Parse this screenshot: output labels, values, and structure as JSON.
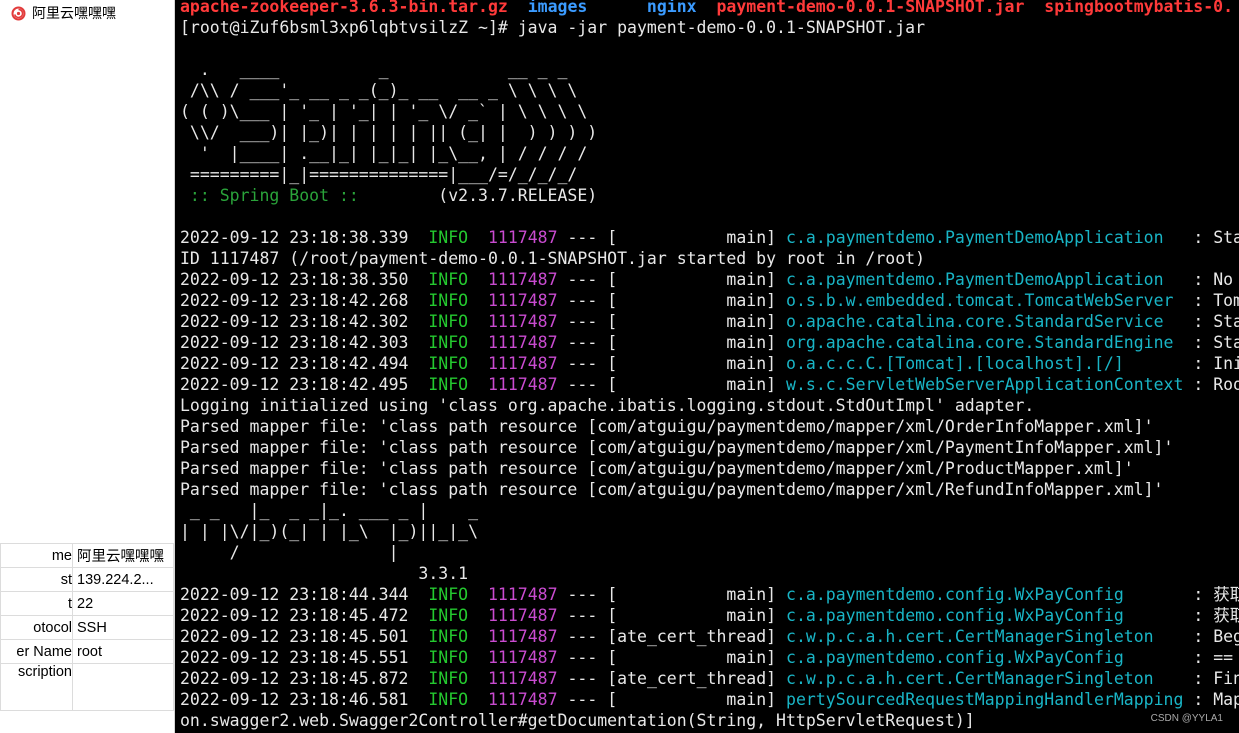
{
  "sidebar": {
    "session_name": "阿里云嘿嘿嘿",
    "properties": [
      {
        "key": "me",
        "value": "阿里云嘿嘿嘿"
      },
      {
        "key": "st",
        "value": "139.224.2..."
      },
      {
        "key": "t",
        "value": "22"
      },
      {
        "key": "otocol",
        "value": "SSH"
      },
      {
        "key": "er Name",
        "value": "root"
      },
      {
        "key": "scription",
        "value": ""
      }
    ]
  },
  "terminal": {
    "listing": [
      "apache-zookeeper-3.6.3-bin.tar.gz",
      "images",
      "nginx",
      "payment-demo-0.0.1-SNAPSHOT.jar",
      "spingbootmybatis-0."
    ],
    "prompt": "[root@iZuf6bsml3xp6lqbtvsilzZ ~]# java -jar payment-demo-0.0.1-SNAPSHOT.jar",
    "spring_banner": [
      "  .   ____          _            __ _ _",
      " /\\\\ / ___'_ __ _ _(_)_ __  __ _ \\ \\ \\ \\",
      "( ( )\\___ | '_ | '_| | '_ \\/ _` | \\ \\ \\ \\",
      " \\\\/  ___)| |_)| | | | | || (_| |  ) ) ) )",
      "  '  |____| .__|_| |_|_| |_\\__, | / / / /",
      " =========|_|==============|___/=/_/_/_/"
    ],
    "spring_boot_label": " :: Spring Boot :: ",
    "spring_boot_version": "       (v2.3.7.RELEASE)",
    "mybatis_banner": [
      " _ _   |_  _ _|_. ___ _ |    _",
      "| | |\\/|_)(_| | |_\\  |_)||_|_\\",
      "     /               |"
    ],
    "mybatis_version": "                        3.3.1",
    "log_group_1": [
      {
        "time": "2022-09-12 23:18:38.339",
        "level": "INFO",
        "pid": "1117487",
        "sep": " --- ",
        "thread": "[           main]",
        "logger": "c.a.paymentdemo.PaymentDemoApplication  ",
        "msg": " : Sta"
      },
      {
        "plain": "ID 1117487 (/root/payment-demo-0.0.1-SNAPSHOT.jar started by root in /root)"
      },
      {
        "time": "2022-09-12 23:18:38.350",
        "level": "INFO",
        "pid": "1117487",
        "sep": " --- ",
        "thread": "[           main]",
        "logger": "c.a.paymentdemo.PaymentDemoApplication  ",
        "msg": " : No"
      },
      {
        "time": "2022-09-12 23:18:42.268",
        "level": "INFO",
        "pid": "1117487",
        "sep": " --- ",
        "thread": "[           main]",
        "logger": "o.s.b.w.embedded.tomcat.TomcatWebServer ",
        "msg": " : Tom"
      },
      {
        "time": "2022-09-12 23:18:42.302",
        "level": "INFO",
        "pid": "1117487",
        "sep": " --- ",
        "thread": "[           main]",
        "logger": "o.apache.catalina.core.StandardService  ",
        "msg": " : Sta"
      },
      {
        "time": "2022-09-12 23:18:42.303",
        "level": "INFO",
        "pid": "1117487",
        "sep": " --- ",
        "thread": "[           main]",
        "logger": "org.apache.catalina.core.StandardEngine ",
        "msg": " : Sta"
      },
      {
        "time": "2022-09-12 23:18:42.494",
        "level": "INFO",
        "pid": "1117487",
        "sep": " --- ",
        "thread": "[           main]",
        "logger": "o.a.c.c.C.[Tomcat].[localhost].[/]      ",
        "msg": " : Ini"
      },
      {
        "time": "2022-09-12 23:18:42.495",
        "level": "INFO",
        "pid": "1117487",
        "sep": " --- ",
        "thread": "[           main]",
        "logger": "w.s.c.ServletWebServerApplicationContext",
        "msg": " : Roo"
      },
      {
        "plain": "Logging initialized using 'class org.apache.ibatis.logging.stdout.StdOutImpl' adapter."
      },
      {
        "plain": "Parsed mapper file: 'class path resource [com/atguigu/paymentdemo/mapper/xml/OrderInfoMapper.xml]'"
      },
      {
        "plain": "Parsed mapper file: 'class path resource [com/atguigu/paymentdemo/mapper/xml/PaymentInfoMapper.xml]'"
      },
      {
        "plain": "Parsed mapper file: 'class path resource [com/atguigu/paymentdemo/mapper/xml/ProductMapper.xml]'"
      },
      {
        "plain": "Parsed mapper file: 'class path resource [com/atguigu/paymentdemo/mapper/xml/RefundInfoMapper.xml]'"
      }
    ],
    "log_group_2": [
      {
        "time": "2022-09-12 23:18:44.344",
        "level": "INFO",
        "pid": "1117487",
        "sep": " --- ",
        "thread": "[           main]",
        "logger": "c.a.paymentdemo.config.WxPayConfig      ",
        "msg": " : 获取"
      },
      {
        "time": "2022-09-12 23:18:45.472",
        "level": "INFO",
        "pid": "1117487",
        "sep": " --- ",
        "thread": "[           main]",
        "logger": "c.a.paymentdemo.config.WxPayConfig      ",
        "msg": " : 获取"
      },
      {
        "time": "2022-09-12 23:18:45.501",
        "level": "INFO",
        "pid": "1117487",
        "sep": " --- ",
        "thread": "[ate_cert_thread]",
        "logger": "c.w.p.c.a.h.cert.CertManagerSingleton   ",
        "msg": " : Beg"
      },
      {
        "time": "2022-09-12 23:18:45.551",
        "level": "INFO",
        "pid": "1117487",
        "sep": " --- ",
        "thread": "[           main]",
        "logger": "c.a.paymentdemo.config.WxPayConfig      ",
        "msg": " : =="
      },
      {
        "time": "2022-09-12 23:18:45.872",
        "level": "INFO",
        "pid": "1117487",
        "sep": " --- ",
        "thread": "[ate_cert_thread]",
        "logger": "c.w.p.c.a.h.cert.CertManagerSingleton   ",
        "msg": " : Fin"
      },
      {
        "time": "2022-09-12 23:18:46.581",
        "level": "INFO",
        "pid": "1117487",
        "sep": " --- ",
        "thread": "[           main]",
        "logger": "pertySourcedRequestMappingHandlerMapping",
        "msg": " : Map"
      },
      {
        "plain": "on.swagger2.web.Swagger2Controller#getDocumentation(String, HttpServletRequest)]"
      }
    ]
  },
  "watermark": "CSDN @YYLA1",
  "colors": {
    "red": "#ff3a3a",
    "blue": "#3b9bff",
    "info_green": "#24c92f",
    "pid_magenta": "#c94bd0",
    "logger_cyan": "#19b5c6"
  }
}
